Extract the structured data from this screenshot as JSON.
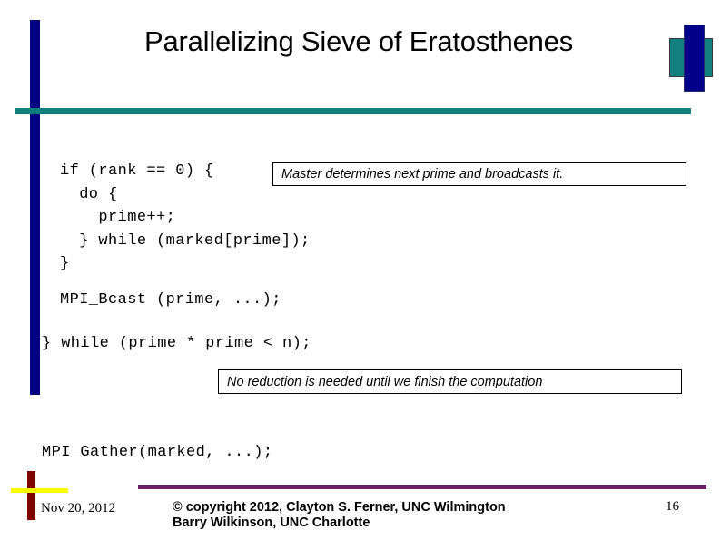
{
  "slide": {
    "title": "Parallelizing Sieve of Eratosthenes",
    "page_number": "16"
  },
  "code": {
    "block_1": "if (rank == 0) {\n  do {\n    prime++;\n  } while (marked[prime]);\n}",
    "bcast_line": "MPI_Bcast (prime, ...);",
    "while_line": "} while (prime * prime < n);",
    "gather_line": "MPI_Gather(marked, ...);"
  },
  "callouts": {
    "master": "Master determines next prime and broadcasts it.",
    "reduction": "No reduction is needed until we finish the computation"
  },
  "footer": {
    "date": "Nov 20, 2012",
    "copyright": "© copyright 2012, Clayton S. Ferner, UNC Wilmington\nBarry Wilkinson, UNC Charlotte",
    "page_number": "16"
  },
  "colors": {
    "navy": "#000080",
    "teal": "#12807F",
    "dark_red": "#800000",
    "yellow": "#FFFF00",
    "purple": "#6B1F6B",
    "text": "#000000",
    "background": "#FFFFFF"
  }
}
